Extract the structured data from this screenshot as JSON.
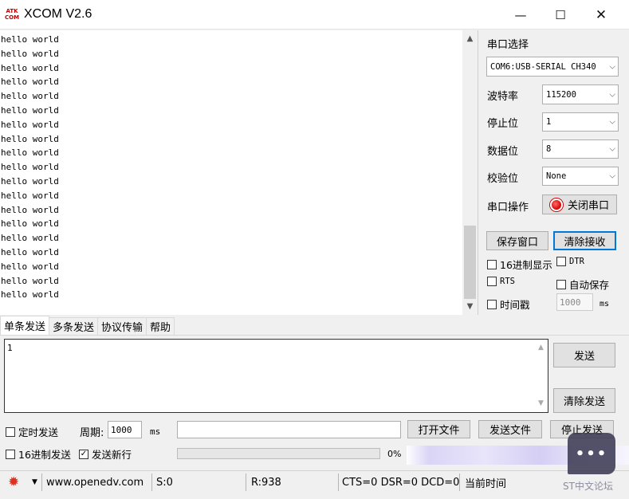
{
  "window": {
    "icon_text": "ATK\nCOM",
    "title": "XCOM V2.6",
    "minimize_glyph": "—",
    "maximize_glyph": "☐",
    "close_glyph": "✕"
  },
  "receive": {
    "lines": [
      "hello world",
      "hello world",
      "hello world",
      "hello world",
      "hello world",
      "hello world",
      "hello world",
      "hello world",
      "hello world",
      "hello world",
      "hello world",
      "hello world",
      "hello world",
      "hello world",
      "hello world",
      "hello world",
      "hello world",
      "hello world",
      "hello world"
    ]
  },
  "serial": {
    "port_select_label": "串口选择",
    "port_value": "COM6:USB-SERIAL CH340",
    "baud_label": "波特率",
    "baud_value": "115200",
    "stop_label": "停止位",
    "stop_value": "1",
    "data_label": "数据位",
    "data_value": "8",
    "parity_label": "校验位",
    "parity_value": "None",
    "operation_label": "串口操作",
    "close_port_button": "关闭串口",
    "save_window_button": "保存窗口",
    "clear_receive_button": "清除接收",
    "hex_display_label": "16进制显示",
    "dtr_label": "DTR",
    "rts_label": "RTS",
    "auto_save_label": "自动保存",
    "timestamp_label": "时间戳",
    "timestamp_interval": "1000",
    "timestamp_unit": "ms"
  },
  "tabs": [
    "单条发送",
    "多条发送",
    "协议传输",
    "帮助"
  ],
  "send": {
    "text": "1",
    "send_button": "发送",
    "clear_send_button": "清除发送",
    "timed_send_label": "定时发送",
    "period_label": "周期:",
    "period_value": "1000",
    "period_unit": "ms",
    "file_path": "",
    "open_file_button": "打开文件",
    "send_file_button": "发送文件",
    "stop_send_button": "停止发送",
    "hex_send_label": "16进制发送",
    "send_newline_label": "发送新行",
    "send_newline_checked": true,
    "progress_percent": 0,
    "progress_text": "0%"
  },
  "status": {
    "url": "www.openedv.com",
    "sent": "S:0",
    "received": "R:938",
    "lines": "CTS=0 DSR=0 DCD=0",
    "time_label": "当前时间"
  },
  "overlay": {
    "watermark": "ST中文论坛",
    "chat_icon": "chat-bubble-icon"
  },
  "colors": {
    "close_led": "#d40000",
    "gear": "#e0301e",
    "focus_border": "#0078d7"
  }
}
